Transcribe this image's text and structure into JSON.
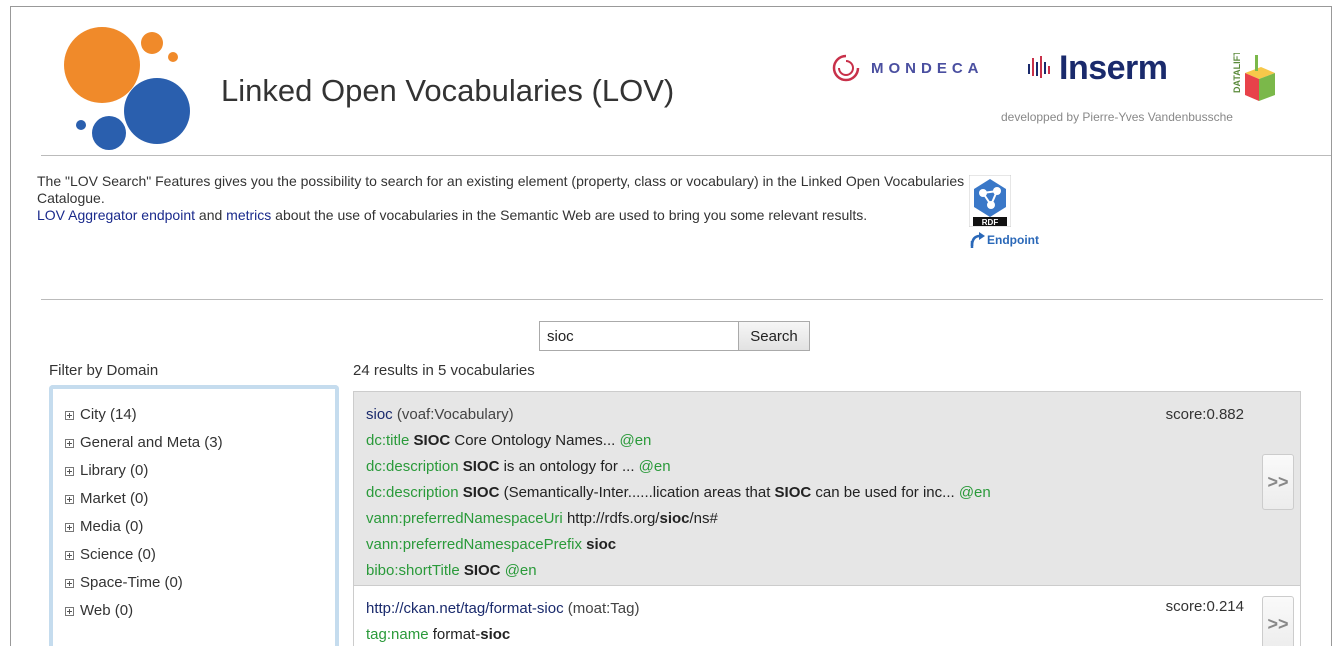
{
  "header": {
    "site_title": "Linked Open Vocabularies (LOV)",
    "mondeca": "MONDECA",
    "inserm": "Inserm",
    "datalift": "DATALIFT",
    "developed_by": "developped by Pierre-Yves Vandenbussche"
  },
  "intro": {
    "line1": "The \"LOV Search\" Features gives you the possibility to search for an existing element (property, class or vocabulary) in the Linked Open Vocabularies Catalogue.",
    "link1": "LOV Aggregator endpoint",
    "and": " and ",
    "link2": "metrics",
    "line2_rest": " about the use of vocabularies in the Semantic Web are used to bring you some relevant results.",
    "rdf_label": "RDF",
    "endpoint_label": "Endpoint"
  },
  "search": {
    "value": "sioc",
    "button_label": "Search"
  },
  "filter": {
    "title": "Filter by Domain",
    "domains": [
      {
        "label": "City (14)"
      },
      {
        "label": "General and Meta (3)"
      },
      {
        "label": "Library (0)"
      },
      {
        "label": "Market (0)"
      },
      {
        "label": "Media (0)"
      },
      {
        "label": "Science (0)"
      },
      {
        "label": "Space-Time (0)"
      },
      {
        "label": "Web (0)"
      }
    ]
  },
  "results": {
    "summary": "24 results in 5 vocabularies",
    "r1": {
      "title": "sioc",
      "type": "(voaf:Vocabulary)",
      "score": "score:0.882",
      "l1_prop": "dc:title",
      "l1_b": "SIOC",
      "l1_rest": " Core Ontology Names...",
      "l1_lang": "@en",
      "l2_prop": "dc:description",
      "l2_b": "SIOC",
      "l2_rest": " is an ontology for ...",
      "l2_lang": "@en",
      "l3_prop": "dc:description",
      "l3_b": "SIOC",
      "l3_mid": " (Semantically-Inter......lication areas that ",
      "l3_b2": "SIOC",
      "l3_rest": " can be used for inc...",
      "l3_lang": "@en",
      "l4_prop": "vann:preferredNamespaceUri",
      "l4_pre": "http://rdfs.org/",
      "l4_b": "sioc",
      "l4_post": "/ns#",
      "l5_prop": "vann:preferredNamespacePrefix",
      "l5_b": "sioc",
      "l6_prop": "bibo:shortTitle",
      "l6_b": "SIOC",
      "l6_lang": "@en",
      "more": ">>"
    },
    "r2": {
      "title": "http://ckan.net/tag/format-sioc",
      "type": "(moat:Tag)",
      "score": "score:0.214",
      "l1_prop": "tag:name",
      "l1_pre": "format-",
      "l1_b": "sioc",
      "more": ">>"
    }
  },
  "colors": {
    "link": "#1a2a8c",
    "property_green": "#2a9a3a",
    "logo_orange": "#f08a2a",
    "logo_blue": "#2a5fae",
    "filter_border": "#c5dcee"
  }
}
